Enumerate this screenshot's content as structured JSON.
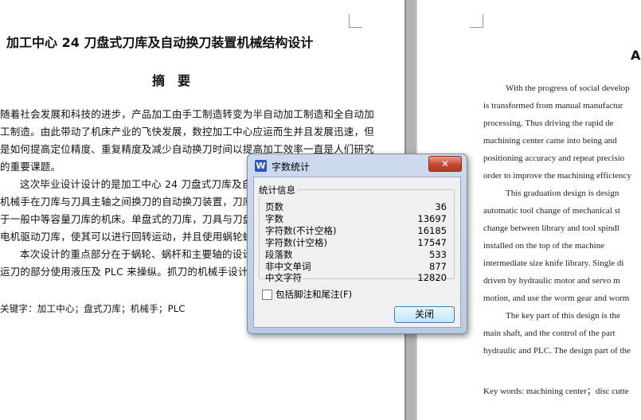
{
  "left_page": {
    "title": "加工中心 24 刀盘式刀库及自动换刀装置机械结构设计",
    "abstract_heading": "摘　要",
    "lines": [
      "随着社会发展和科技的进步，产品加工由手工制造转变为半自动加工制造和全自动加",
      "工制造。由此带动了机床产业的飞快发展，数控加工中心应运而生并且发展迅速，但",
      "是如何提高定位精度、重复精度及减少自动换刀时间以提高加工效率一直是人们研究",
      "的重要课题。",
      "这次毕业设计设计的是加工中心 24 刀盘式刀库及自动换刀",
      "机械手在刀库与刀具主轴之间换刀的自动换刀装置，刀库安装",
      "于一般中等容量刀库的机床。单盘式的刀库，刀具与刀盘垂直",
      "电机驱动刀库，使其可以进行回转运动，并且使用蜗轮蜗杆",
      "本次设计的重点部分在于蜗轮、蜗杆和主要轴的设计计",
      "运刀的部分使用液压及 PLC 来操纵。抓刀的机械手设计部分"
    ],
    "keywords": "关键字：加工中心；盘式刀库；机械手；PLC"
  },
  "right_page": {
    "heading_fragment": "A",
    "lines": [
      "With the progress of social develop",
      "is transformed from manual manufactur",
      "processing. Thus driving the rapid de",
      "machining center came into being and",
      "positioning accuracy and repeat precisio",
      "order to improve the machining efficiency",
      "This graduation design is design",
      "automatic tool change of mechanical st",
      "change between library and tool spindl",
      "installed on the top of the machine",
      "intermediate size knife library. Single di",
      "driven by hydraulic motor and servo m",
      "motion, and use the worm gear and worm",
      "The key part of this design is the",
      "main shaft, and the control of the part",
      "hydraulic and PLC. The design part of the"
    ],
    "keywords": "Key words: machining center；disc cutte"
  },
  "dialog": {
    "title": "字数统计",
    "app_icon_letter": "W",
    "close_x": "✕",
    "group_label": "统计信息",
    "stats": [
      {
        "label": "页数",
        "value": "36"
      },
      {
        "label": "字数",
        "value": "13697"
      },
      {
        "label": "字符数(不计空格)",
        "value": "16185"
      },
      {
        "label": "字符数(计空格)",
        "value": "17547"
      },
      {
        "label": "段落数",
        "value": "533"
      },
      {
        "label": "非中文单词",
        "value": "877"
      },
      {
        "label": "中文字符",
        "value": "12820"
      }
    ],
    "checkbox_label": "包括脚注和尾注(F)",
    "checkbox_checked": false,
    "close_button": "关闭"
  }
}
